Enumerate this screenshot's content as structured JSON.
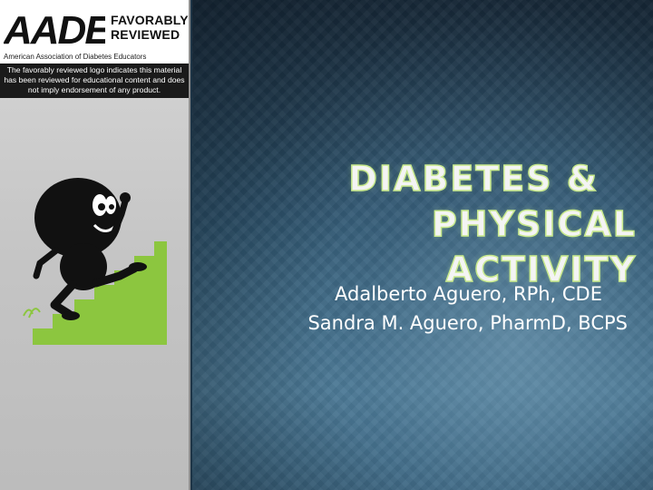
{
  "logo": {
    "wordmark": "AADE",
    "badge_line1": "FAVORABLY",
    "badge_line2": "REVIEWED",
    "organization": "American Association of Diabetes Educators",
    "disclaimer_line1": "The favorably reviewed logo indicates this material",
    "disclaimer_line2": "has been reviewed for educational content and does",
    "disclaimer_line3": "not imply endorsement of any product."
  },
  "title": {
    "line1": "Diabetes &",
    "line2": "Physical Activity"
  },
  "authors": {
    "line1": "Adalberto Aguero, RPh, CDE",
    "line2": "Sandra M. Aguero, PharmD, BCPS"
  },
  "colors": {
    "stair_green": "#8cc63f",
    "title_glow": "#c9ea8e",
    "background_blue": "#3b6580",
    "panel_grey": "#c8c8c8"
  },
  "icons": {
    "illustration": "running-figure-on-stairs-icon",
    "logo": "aade-logo-icon"
  }
}
